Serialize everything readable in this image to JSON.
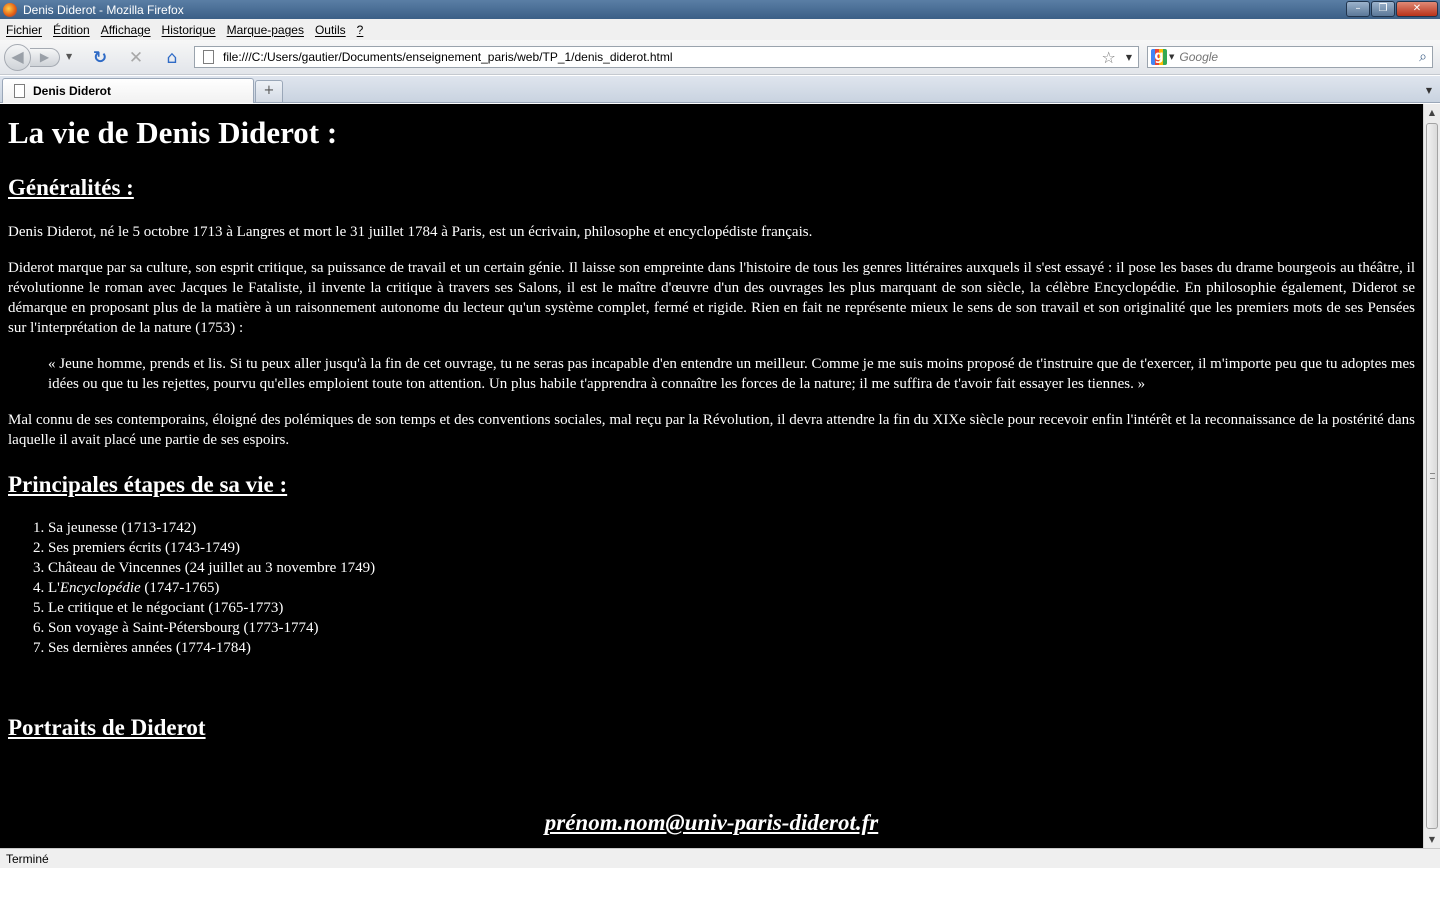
{
  "window": {
    "title": "Denis Diderot - Mozilla Firefox"
  },
  "menu": [
    "Fichier",
    "Édition",
    "Affichage",
    "Historique",
    "Marque-pages",
    "Outils",
    "?"
  ],
  "nav": {
    "url": "file:///C:/Users/gautier/Documents/enseignement_paris/web/TP_1/denis_diderot.html"
  },
  "search": {
    "placeholder": "Google"
  },
  "tabs": [
    {
      "label": "Denis Diderot"
    }
  ],
  "page": {
    "h1": "La vie de Denis Diderot :",
    "section1_heading": "Généralités :",
    "p1": "Denis Diderot, né le 5 octobre 1713 à Langres et mort le 31 juillet 1784 à Paris, est un écrivain, philosophe et encyclopédiste français.",
    "p2": "Diderot marque par sa culture, son esprit critique, sa puissance de travail et un certain génie. Il laisse son empreinte dans l'histoire de tous les genres littéraires auxquels il s'est essayé : il pose les bases du drame bourgeois au théâtre, il révolutionne le roman avec Jacques le Fataliste, il invente la critique à travers ses Salons, il est le maître d'œuvre d'un des ouvrages les plus marquant de son siècle, la célèbre Encyclopédie. En philosophie également, Diderot se démarque en proposant plus de la matière à un raisonnement autonome du lecteur qu'un système complet, fermé et rigide. Rien en fait ne représente mieux le sens de son travail et son originalité que les premiers mots de ses Pensées sur l'interprétation de la nature (1753) :",
    "quote": "« Jeune homme, prends et lis. Si tu peux aller jusqu'à la fin de cet ouvrage, tu ne seras pas incapable d'en entendre un meilleur. Comme je me suis moins proposé de t'instruire que de t'exercer, il m'importe peu que tu adoptes mes idées ou que tu les rejettes, pourvu qu'elles emploient toute ton attention. Un plus habile t'apprendra à connaître les forces de la nature; il me suffira de t'avoir fait essayer les tiennes. »",
    "p3": "Mal connu de ses contemporains, éloigné des polémiques de son temps et des conventions sociales, mal reçu par la Révolution, il devra attendre la fin du XIXe siècle pour recevoir enfin l'intérêt et la reconnaissance de la postérité dans laquelle il avait placé une partie de ses espoirs.",
    "section2_heading": "Principales étapes de sa vie :",
    "steps": [
      "Sa jeunesse (1713-1742)",
      "Ses premiers écrits (1743-1749)",
      "Château de Vincennes (24 juillet au 3 novembre 1749)",
      {
        "prefix": "L'",
        "italic": "Encyclopédie",
        "suffix": " (1747-1765)"
      },
      "Le critique et le négociant (1765-1773)",
      "Son voyage à Saint-Pétersbourg (1773-1774)",
      "Ses dernières années (1774-1784)"
    ],
    "section3_heading": "Portraits de Diderot",
    "email": "prénom.nom@univ-paris-diderot.fr"
  },
  "status": "Terminé",
  "colors": {
    "page_bg": "#000000",
    "page_text": "#ffffff",
    "titlebar": "#3b5f86"
  }
}
